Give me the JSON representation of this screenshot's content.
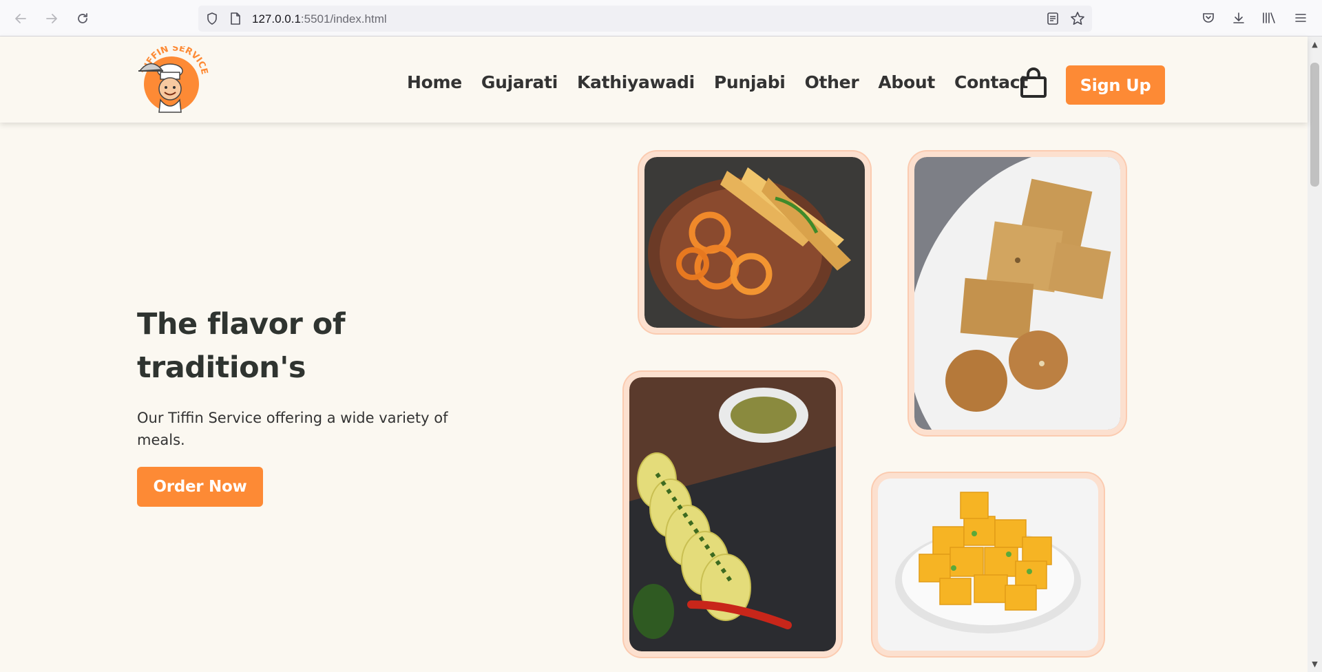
{
  "browser": {
    "url_host": "127.0.0.1",
    "url_rest": ":5501/index.html"
  },
  "header": {
    "logo_text": "TIFFIN SERVICE",
    "nav": [
      "Home",
      "Gujarati",
      "Kathiyawadi",
      "Punjabi",
      "Other",
      "About",
      "Contact"
    ],
    "signup_label": "Sign Up"
  },
  "hero": {
    "title_line1": "The flavor of",
    "title_line2": "tradition's",
    "subtitle": "Our Tiffin Service offering a wide variety of meals.",
    "order_label": "Order Now"
  },
  "images": [
    {
      "name": "jalebi-fafda-image"
    },
    {
      "name": "sweets-barfi-ladoo-image"
    },
    {
      "name": "khandvi-image"
    },
    {
      "name": "dhokla-image"
    }
  ],
  "colors": {
    "accent": "#fd8a35",
    "page_bg": "#fbf8f1",
    "tile_border": "#fce0cf",
    "text_dark": "#2f3430"
  }
}
